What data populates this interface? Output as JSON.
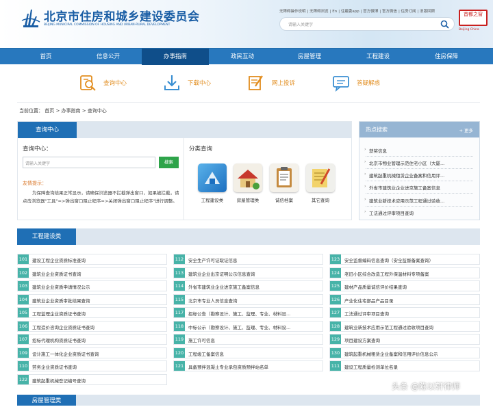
{
  "header": {
    "title": "北京市住房和城乡建设委员会",
    "subtitle": "BEIJING MUNICIPAL COMMISSION OF HOUSING AND URBAN-RURAL DEVELOPMENT",
    "links": [
      "无障碍操作说明",
      "无障碍浏览",
      "En",
      "住建委app",
      "官方微博",
      "官方微信",
      "住房订阅",
      "旧版回顾"
    ],
    "search_placeholder": "请输入关键字",
    "seal_text": "首都之窗",
    "seal_sub": "Beijing China"
  },
  "nav": [
    "首页",
    "信息公开",
    "办事指南",
    "政民互动",
    "房屋管理",
    "工程建设",
    "住房保障"
  ],
  "quick": [
    "查询中心",
    "下载中心",
    "网上投诉",
    "答疑解惑"
  ],
  "breadcrumb": "当前位置： 首页 > 办事指南 > 查询中心",
  "query": {
    "tab": "查询中心",
    "label": "查询中心：",
    "placeholder": "请输入关键字",
    "button": "搜索",
    "tip_title": "友情提示：",
    "tip_body": "为保障查询结果正常显示，请确保浏览器不拦截弹出窗口，如果被拦截，请点击浏览器\"工具\"=>弹出窗口阻止程序=>关闭弹出窗口阻止程序\"进行调整。",
    "class_title": "分类查询",
    "classes": [
      "工程建设类",
      "房屋管理类",
      "诚信档案",
      "其它查询"
    ]
  },
  "hot": {
    "title": "热点搜索",
    "more": "+ 更多",
    "items": [
      "获奖信息",
      "北京市物业管理示范住宅小区（大厦...",
      "建筑起重机械租赁企业备案和信用评...",
      "外省市建筑业企业进京施工备案信息",
      "建筑业新技术应用示范工程通过验收...",
      "工法通过评审项目查询"
    ]
  },
  "eng": {
    "title": "工程建设类",
    "items": [
      {
        "num": "101",
        "text": "建设工程企业资质标准查询"
      },
      {
        "num": "112",
        "text": "安全生产许可证取证信息"
      },
      {
        "num": "123",
        "text": "安全监督编码信息查询（安全监督备案查询）"
      },
      {
        "num": "102",
        "text": "建筑业企业资质证书查询"
      },
      {
        "num": "113",
        "text": "建筑业企业出京证明公示信息查询"
      },
      {
        "num": "124",
        "text": "老旧小区综合改造工程外保温材料专项备案"
      },
      {
        "num": "103",
        "text": "建筑业企业资质申请情况公示"
      },
      {
        "num": "114",
        "text": "外省市建筑业企业进京施工备案信息"
      },
      {
        "num": "125",
        "text": "建材产品质量诚信评价结果查询"
      },
      {
        "num": "104",
        "text": "建筑业企业资质审批结果查询"
      },
      {
        "num": "115",
        "text": "北京市专业人员信息查询"
      },
      {
        "num": "126",
        "text": "产业化住宅部品产品目录"
      },
      {
        "num": "105",
        "text": "工程监理企业资质证书查询"
      },
      {
        "num": "117",
        "text": "招标公告（勘察设计、施工、监理、专业、材料设..."
      },
      {
        "num": "127",
        "text": "工法通过评审项目查询"
      },
      {
        "num": "106",
        "text": "工程造价咨询企业资质证书查询"
      },
      {
        "num": "118",
        "text": "中标公示（勘察设计、施工、监理、专业、材料设..."
      },
      {
        "num": "128",
        "text": "建筑业新技术应用示范工程通过验收项目查询"
      },
      {
        "num": "107",
        "text": "招标代理机构资质证书查询"
      },
      {
        "num": "119",
        "text": "施工许可信息"
      },
      {
        "num": "129",
        "text": "项目建设方案查询"
      },
      {
        "num": "109",
        "text": "设计施工一体化企业资质证书查询"
      },
      {
        "num": "120",
        "text": "工程竣工备案信息"
      },
      {
        "num": "130",
        "text": "建筑起重机械租赁企业备案和信用评价信息公示"
      },
      {
        "num": "110",
        "text": "劳务企业资质证书查询"
      },
      {
        "num": "121",
        "text": "具备预拌混凝土专业承包资质预拌站名单"
      },
      {
        "num": "111",
        "text": "建设工程质量检测单位名录"
      },
      {
        "num": "122",
        "text": "建筑起重机械登记编号查询"
      }
    ]
  },
  "next_section": "房屋管理类",
  "watermark": "头条 @陈以轩律师"
}
